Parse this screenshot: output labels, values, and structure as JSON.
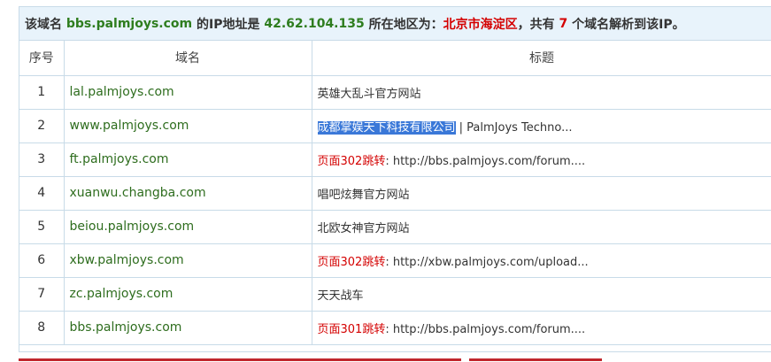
{
  "summary": {
    "prefix": "该域名",
    "domain": "bbs.palmjoys.com",
    "ip_text": "的IP地址是",
    "ip": "42.62.104.135",
    "region_text": "所在地区为：",
    "region": "北京市海淀区",
    "count_prefix": "，共有",
    "count": "7",
    "count_suffix": "个域名解析到该IP。"
  },
  "table": {
    "headers": [
      "序号",
      "域名",
      "标题"
    ],
    "rows": [
      {
        "idx": "1",
        "domain": "lal.palmjoys.com",
        "title_red": "",
        "title": "英雄大乱斗官方网站",
        "title_sel": ""
      },
      {
        "idx": "2",
        "domain": "www.palmjoys.com",
        "title_red": "",
        "title": "| PalmJoys Techno...",
        "title_sel": "成都掌娱天下科技有限公司"
      },
      {
        "idx": "3",
        "domain": "ft.palmjoys.com",
        "title_red": "页面302跳转",
        "title": ": http://bbs.palmjoys.com/forum....",
        "title_sel": ""
      },
      {
        "idx": "4",
        "domain": "xuanwu.changba.com",
        "title_red": "",
        "title": "唱吧炫舞官方网站",
        "title_sel": ""
      },
      {
        "idx": "5",
        "domain": "beiou.palmjoys.com",
        "title_red": "",
        "title": "北欧女神官方网站",
        "title_sel": ""
      },
      {
        "idx": "6",
        "domain": "xbw.palmjoys.com",
        "title_red": "页面302跳转",
        "title": ": http://xbw.palmjoys.com/upload...",
        "title_sel": ""
      },
      {
        "idx": "7",
        "domain": "zc.palmjoys.com",
        "title_red": "",
        "title": "天天战车",
        "title_sel": ""
      },
      {
        "idx": "8",
        "domain": "bbs.palmjoys.com",
        "title_red": "页面301跳转",
        "title": ": http://bbs.palmjoys.com/forum....",
        "title_sel": ""
      }
    ]
  }
}
